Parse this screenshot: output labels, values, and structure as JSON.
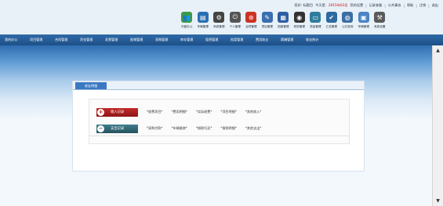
{
  "top_links": {
    "items": [
      "您好: 标题目",
      "今天是:",
      "2015年03月",
      "您的设置",
      "|",
      "记录查看",
      "|",
      "公共事务",
      "|",
      "帮助",
      "|",
      "注销",
      "|",
      "退出"
    ],
    "red_index": 2
  },
  "icons": [
    {
      "name": "office-icon",
      "label": "内部办公",
      "color": "#3a9a4a",
      "glyph": "👥"
    },
    {
      "name": "doc-icon",
      "label": "车辆管理",
      "color": "#2a6fb5",
      "glyph": "▤"
    },
    {
      "name": "gear-icon",
      "label": "系统管理",
      "color": "#444444",
      "glyph": "⚙"
    },
    {
      "name": "power-icon",
      "label": "个人管理",
      "color": "#555555",
      "glyph": "⏻"
    },
    {
      "name": "cart-icon",
      "label": "合同管理",
      "color": "#cc3322",
      "glyph": "⊛"
    },
    {
      "name": "note-icon",
      "label": "项目管理",
      "color": "#3a6fb0",
      "glyph": "✎"
    },
    {
      "name": "book-icon",
      "label": "档案管理",
      "color": "#2d5ea3",
      "glyph": "▦"
    },
    {
      "name": "data-icon",
      "label": "财务管理",
      "color": "#333333",
      "glyph": "◉"
    },
    {
      "name": "money-icon",
      "label": "资金管理",
      "color": "#2f7d9e",
      "glyph": "▭"
    },
    {
      "name": "check-icon",
      "label": "汇总管理",
      "color": "#2d6aa0",
      "glyph": "✔"
    },
    {
      "name": "globe-icon",
      "label": "公共查询",
      "color": "#3c6ea4",
      "glyph": "◍"
    },
    {
      "name": "chat-icon",
      "label": "车辆管理",
      "color": "#4a84c4",
      "glyph": "▣"
    },
    {
      "name": "set-icon",
      "label": "系统设置",
      "color": "#5a5a5a",
      "glyph": "⚒"
    }
  ],
  "nav": [
    "我的办公",
    "项目管理",
    "合同管理",
    "资金管理",
    "发票管理",
    "报销管理",
    "采购管理",
    "库存管理",
    "租赁管理",
    "档案管理",
    "费用收支",
    "薪酬管理",
    "收支统计"
  ],
  "panel": {
    "tab": "收支明细",
    "rows": [
      {
        "button": "收入记录",
        "links": [
          "*收费项目*",
          "*费用明细*",
          "*实际收费*",
          "*项目明细*",
          "*其他收入*"
        ]
      },
      {
        "button": "支出记录",
        "links": [
          "*采购付款*",
          "*车辆维修*",
          "*借款归还*",
          "*报销明细*",
          "*其他支出*"
        ]
      }
    ]
  }
}
